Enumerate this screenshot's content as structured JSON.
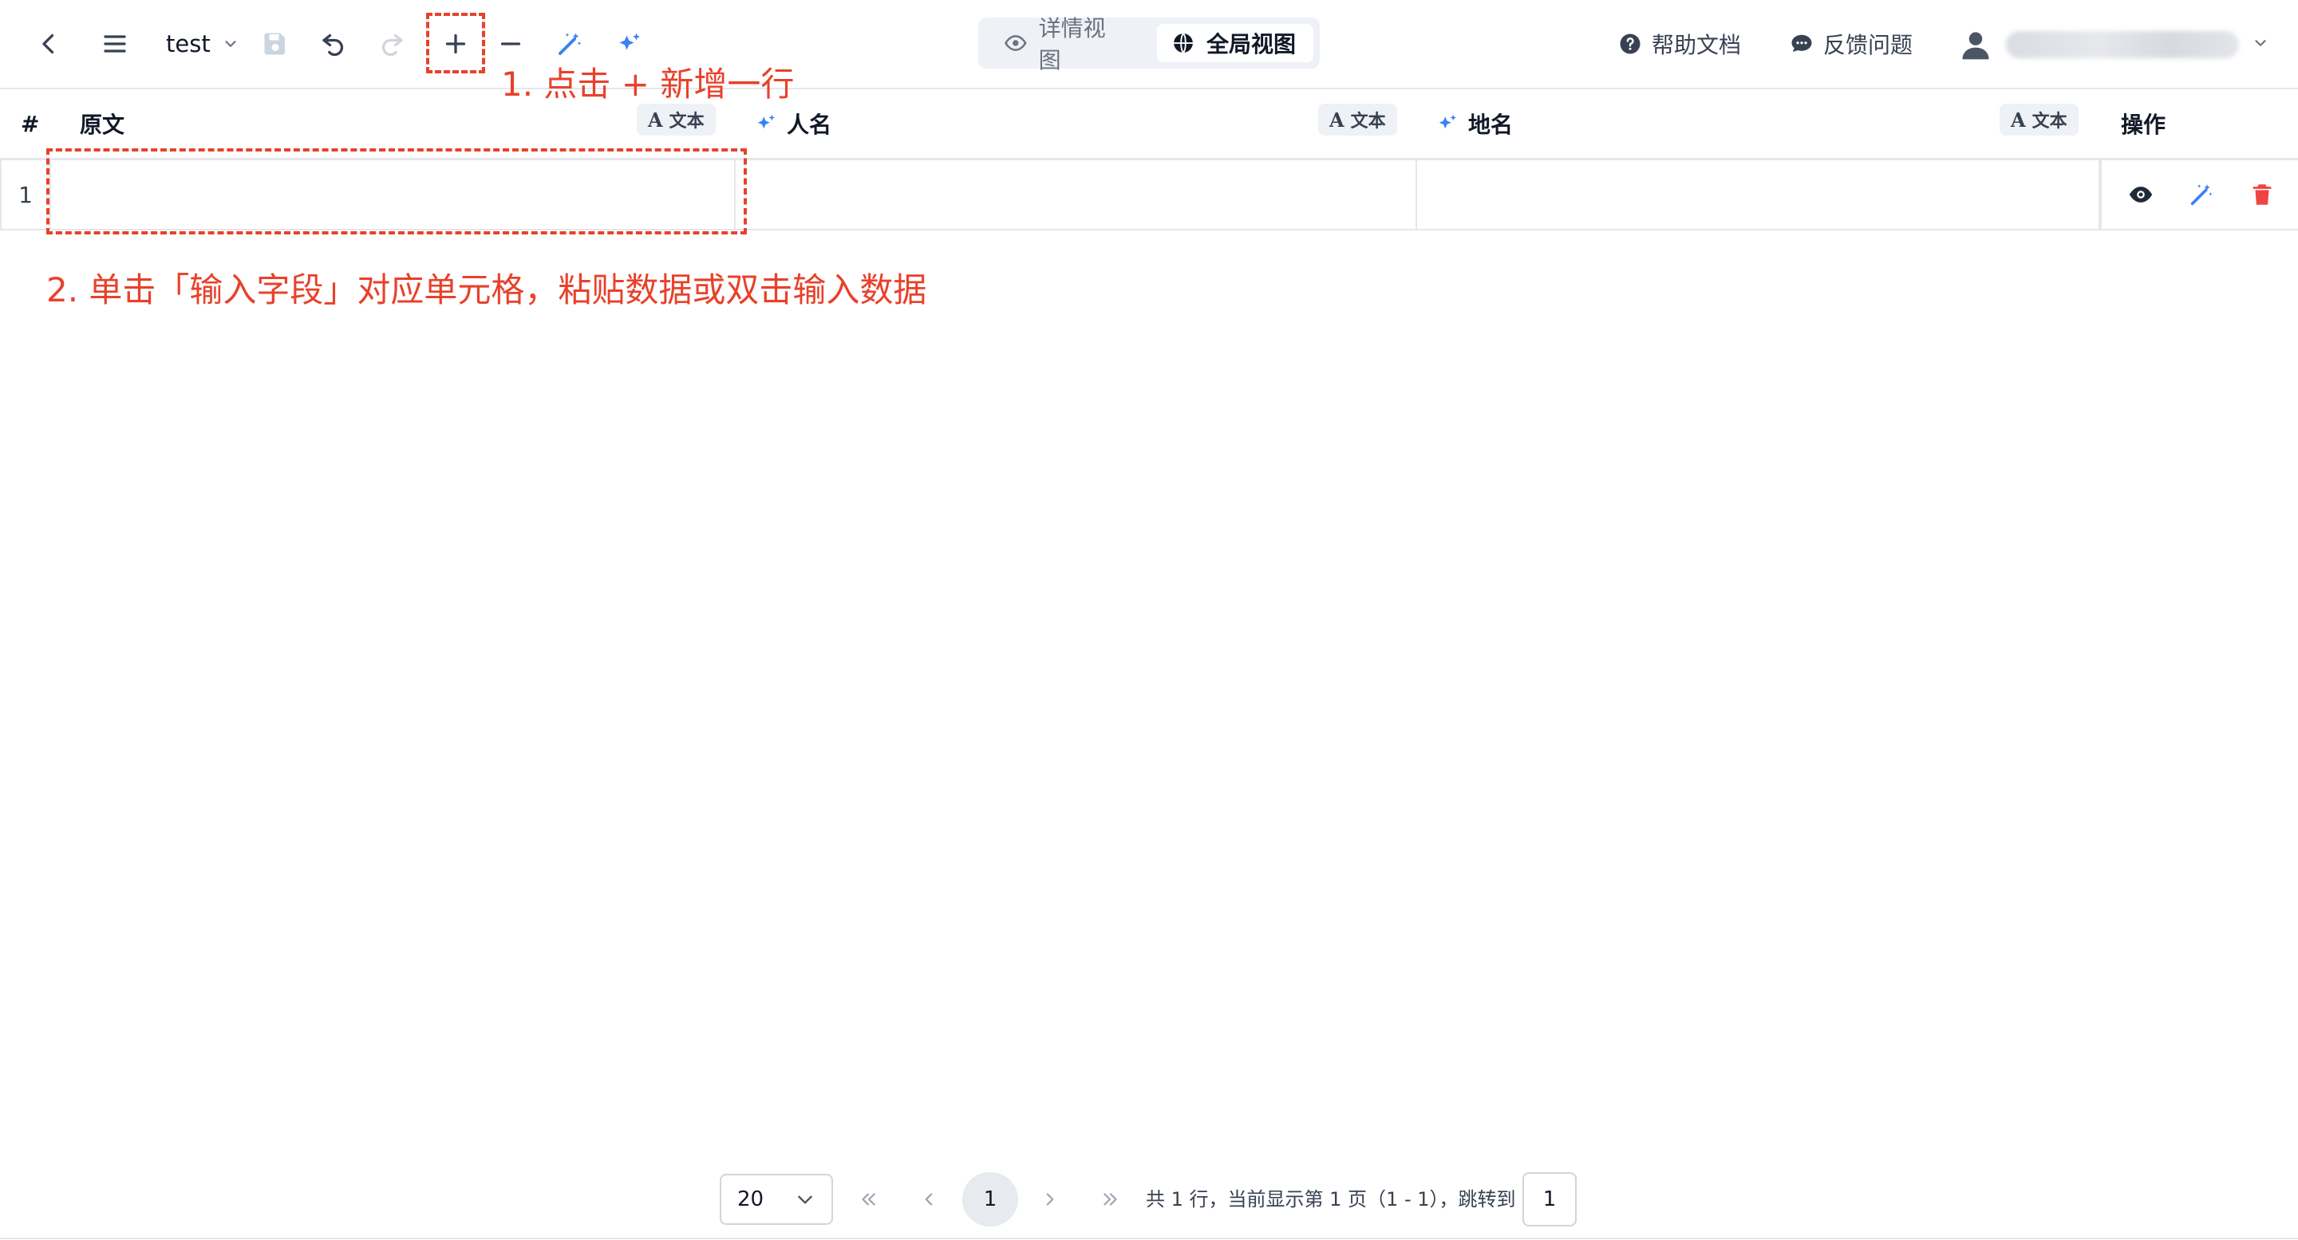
{
  "toolbar": {
    "doc_name": "test",
    "icons": [
      "back-icon",
      "menu-icon",
      "save-icon",
      "undo-icon",
      "redo-icon",
      "plus-icon",
      "minus-icon",
      "magic-wand-icon",
      "sparkle-icon"
    ]
  },
  "views": {
    "detail": "详情视图",
    "global": "全局视图",
    "active": "global"
  },
  "links": {
    "help": "帮助文档",
    "feedback": "反馈问题"
  },
  "table": {
    "index_header": "#",
    "columns": [
      {
        "label": "原文",
        "type": "文本",
        "ai": false
      },
      {
        "label": "人名",
        "type": "文本",
        "ai": true
      },
      {
        "label": "地名",
        "type": "文本",
        "ai": true
      }
    ],
    "actions_header": "操作",
    "rows": [
      {
        "index": "1",
        "cells": [
          "",
          "",
          ""
        ]
      }
    ],
    "type_glyph": "A"
  },
  "annotations": {
    "step1": "1. 点击 + 新增一行",
    "step2": "2. 单击「输入字段」对应单元格，粘贴数据或双击输入数据"
  },
  "pagination": {
    "page_size": "20",
    "current_page": "1",
    "info": "共 1 行，当前显示第 1 页（1 - 1），跳转到",
    "jump_value": "1"
  },
  "colors": {
    "annotation": "#e8412b",
    "accent_blue": "#3b82f6",
    "delete_red": "#ef4444",
    "dark_icon": "#374151"
  }
}
